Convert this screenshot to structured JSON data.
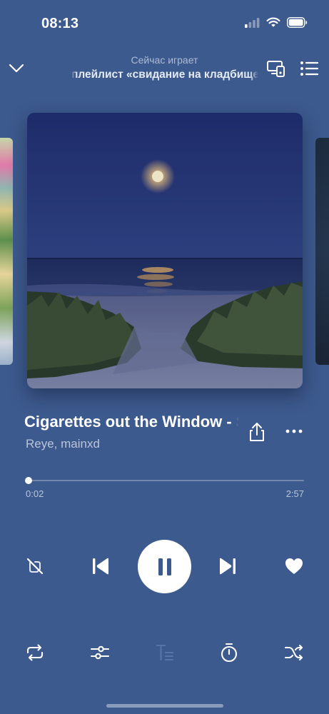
{
  "status_bar": {
    "time": "08:13",
    "icons": [
      "cellular-signal-icon",
      "wifi-icon",
      "battery-icon"
    ]
  },
  "header": {
    "collapse_icon": "chevron-down-icon",
    "label": "Сейчас играет",
    "playlist_title": "плейлист «свидание на кладбище»",
    "device_icon": "device-output-icon",
    "queue_icon": "queue-list-icon"
  },
  "track": {
    "title": "Cigarettes out the Window - Sped Up",
    "artist": "Reye, mainxd",
    "share_icon": "share-icon",
    "more_icon": "more-dots-icon"
  },
  "progress": {
    "current": "0:02",
    "total": "2:57",
    "fraction": 0.0113
  },
  "controls": {
    "dislike_icon": "dislike-icon",
    "prev_icon": "previous-track-icon",
    "play_state": "playing",
    "pause_icon": "pause-icon",
    "next_icon": "next-track-icon",
    "like_icon": "heart-icon"
  },
  "toolbar": {
    "repeat_icon": "repeat-icon",
    "settings_icon": "sliders-icon",
    "lyrics_icon": "lyrics-icon",
    "timer_icon": "timer-icon",
    "shuffle_icon": "shuffle-icon"
  },
  "colors": {
    "background": "#3d5a8e",
    "foreground": "#ffffff",
    "muted_text": "#b9c5da"
  }
}
